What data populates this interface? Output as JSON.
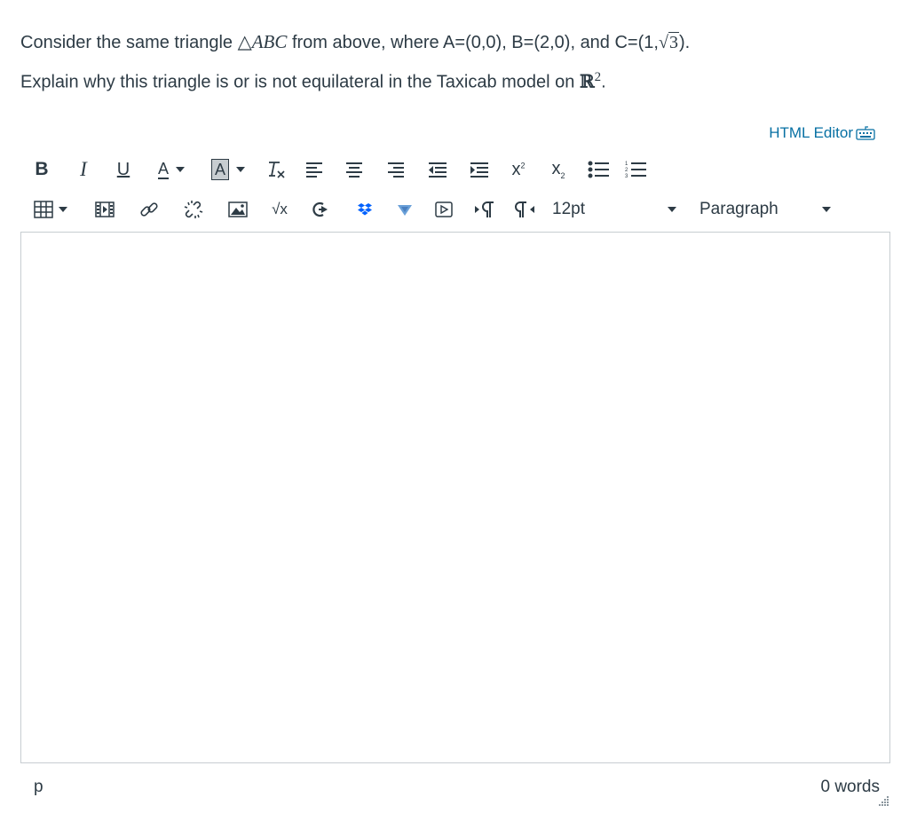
{
  "question": {
    "line1_before": "Consider the same triangle ",
    "triangle_symbol": "△",
    "triangle_name": "ABC",
    "line1_after": " from above, where A=(0,0), B=(2,0), and C=(1,",
    "sqrt_value": "3",
    "line1_end": ").",
    "line2_before": "Explain why this triangle is or is not equilateral in the Taxicab model on ",
    "set_symbol": "ℝ",
    "set_exponent": "2",
    "line2_end": "."
  },
  "editor": {
    "html_editor_label": "HTML Editor",
    "font_size": "12pt",
    "block_format": "Paragraph",
    "status_path": "p",
    "word_count": "0 words"
  },
  "toolbar_labels": {
    "bold": "B",
    "italic": "I",
    "underline": "U",
    "text_color": "A",
    "background_color": "A",
    "superscript": "x",
    "subscript": "x",
    "sqrt": "√x"
  },
  "colors": {
    "text": "#2d3b45",
    "link": "#0770a3",
    "border": "#c7cdd1",
    "dropbox": "#0061fe",
    "vimeo": "#6aa0d8"
  }
}
